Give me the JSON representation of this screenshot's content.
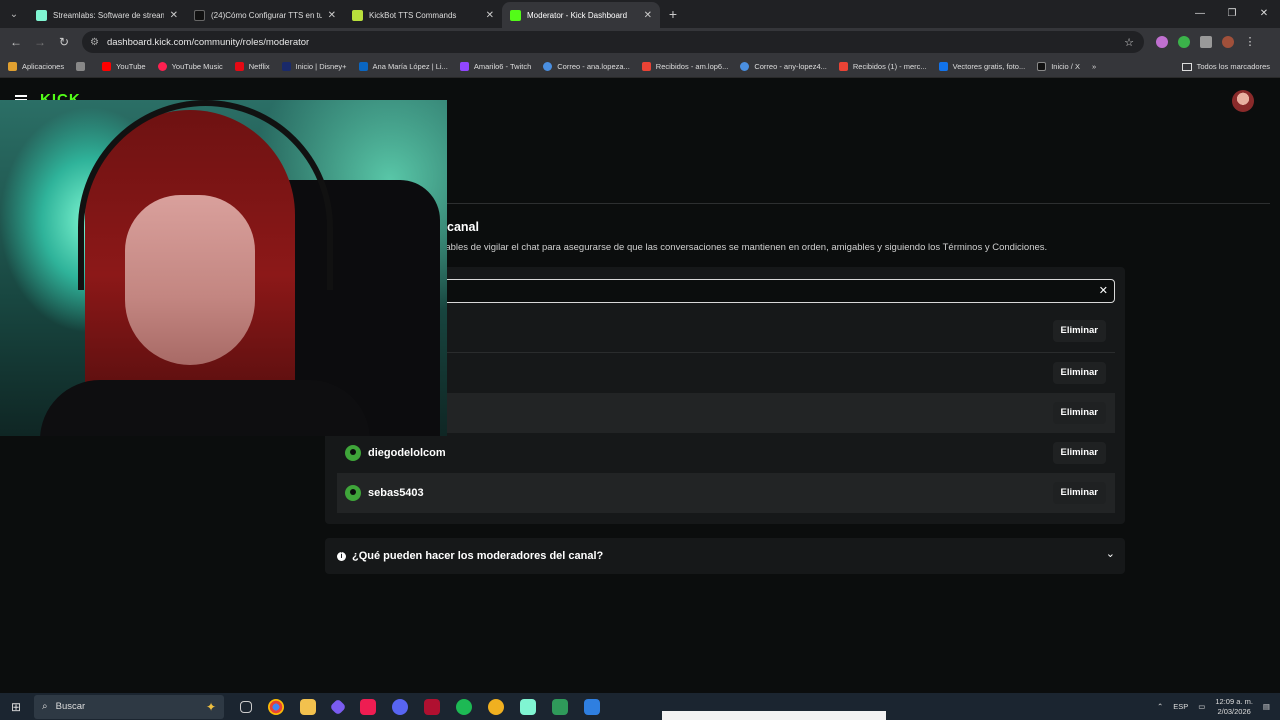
{
  "browser": {
    "tabs": [
      {
        "title": "Streamlabs: Software de streaming",
        "favicon_color": "#80f5d2",
        "active": false
      },
      {
        "title": "(24)Cómo Configurar TTS en tu",
        "favicon_color": "#111111",
        "active": false
      },
      {
        "title": "KickBot TTS Commands",
        "favicon_color": "#b9e03c",
        "active": false
      },
      {
        "title": "Moderator - Kick Dashboard",
        "favicon_color": "#53fc18",
        "active": true
      }
    ],
    "url": "dashboard.kick.com/community/roles/moderator",
    "bookmarks": [
      {
        "label": "Aplicaciones",
        "color": "#e0a030"
      },
      {
        "label": "",
        "color": "#888888"
      },
      {
        "label": "YouTube",
        "color": "#ff0000"
      },
      {
        "label": "YouTube Music",
        "color": "#ff2050"
      },
      {
        "label": "Netflix",
        "color": "#e50914"
      },
      {
        "label": "Inicio | Disney+",
        "color": "#1a2a6a"
      },
      {
        "label": "Ana María López | Li...",
        "color": "#0a66c2"
      },
      {
        "label": "Amarilo6 - Twitch",
        "color": "#9146ff"
      },
      {
        "label": "Correo - ana.lopeza...",
        "color": "#4a8fe0"
      },
      {
        "label": "Recibidos - am.lop6...",
        "color": "#ea4335"
      },
      {
        "label": "Correo - any-lopez4...",
        "color": "#4a8fe0"
      },
      {
        "label": "Recibidos (1) - merc...",
        "color": "#ea4335"
      },
      {
        "label": "Vectores gratis, foto...",
        "color": "#1273eb"
      },
      {
        "label": "Inicio / X",
        "color": "#111111"
      }
    ],
    "more_bookmarks": "Todos los marcadores"
  },
  "page": {
    "section_title": "canal",
    "section_desc": "onsables de vigilar el chat para asegurarse de que las conversaciones se mantienen en orden, amigables y siguiendo los Términos y Condiciones.",
    "search_value": "",
    "remove_label": "Eliminar",
    "moderators": [
      "",
      "",
      "",
      "diegodelolcom",
      "sebas5403"
    ],
    "faq_question": "¿Qué pueden hacer los moderadores del canal?"
  },
  "taskbar": {
    "search_placeholder": "Buscar",
    "language": "ESP",
    "time": "12:09 a. m.",
    "date": "2/03/2026"
  }
}
